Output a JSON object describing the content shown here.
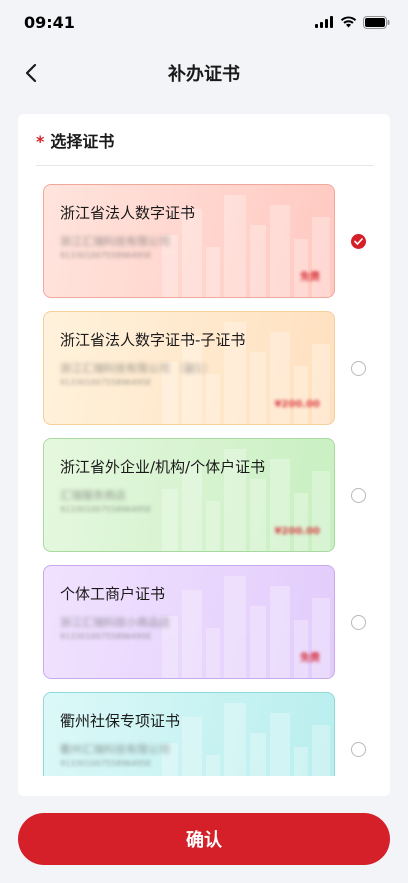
{
  "status_bar": {
    "time": "09:41"
  },
  "nav": {
    "title": "补办证书"
  },
  "section": {
    "required_mark": "*",
    "title": "选择证书"
  },
  "certificates": [
    {
      "title": "浙江省法人数字证书",
      "line1": "浙江汇瑞科技有限公司",
      "line2": "91330100755896495E",
      "price": "免费",
      "selected": true,
      "bg_from": "#ffe4dd",
      "bg_to": "#ffc9c1",
      "border": "#f2a79b"
    },
    {
      "title": "浙江省法人数字证书-子证书",
      "line1": "浙江汇瑞科技有限公司 （副1）",
      "line2": "91330100755896495E",
      "price": "¥200.00",
      "selected": false,
      "bg_from": "#fff2dc",
      "bg_to": "#ffe0bf",
      "border": "#f5cf9c"
    },
    {
      "title": "浙江省外企业/机构/个体户证书",
      "line1": "汇瑞服务商店",
      "line2": "91330100755896495E",
      "price": "¥200.00",
      "selected": false,
      "bg_from": "#e6f8df",
      "bg_to": "#c8efc1",
      "border": "#a8d9a0"
    },
    {
      "title": "个体工商户证书",
      "line1": "浙江汇瑞科技小商品店",
      "line2": "91330100755896495E",
      "price": "免费",
      "selected": false,
      "bg_from": "#f1e2ff",
      "bg_to": "#e2ccfb",
      "border": "#c9a9ec"
    },
    {
      "title": "衢州社保专项证书",
      "line1": "衢州汇瑞科技有限公司",
      "line2": "91330100755896495E",
      "price": "",
      "selected": false,
      "bg_from": "#dcf8f8",
      "bg_to": "#b9eeee",
      "border": "#8fd9d9"
    }
  ],
  "confirm": {
    "label": "确认"
  },
  "colors": {
    "accent": "#d5202a",
    "page_bg": "#f2f4f7"
  }
}
